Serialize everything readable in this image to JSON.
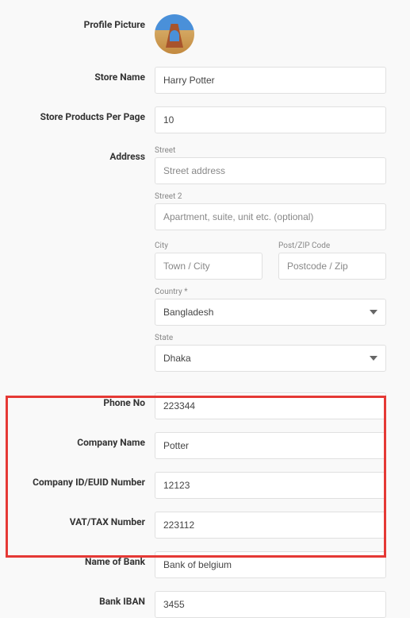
{
  "labels": {
    "profile_picture": "Profile Picture",
    "store_name": "Store Name",
    "products_per_page": "Store Products Per Page",
    "address": "Address",
    "street": "Street",
    "street2": "Street 2",
    "city": "City",
    "postzip": "Post/ZIP Code",
    "country": "Country *",
    "state": "State",
    "phone": "Phone No",
    "company_name": "Company Name",
    "company_id": "Company ID/EUID Number",
    "vat": "VAT/TAX Number",
    "bank_name": "Name of Bank",
    "bank_iban": "Bank IBAN"
  },
  "values": {
    "store_name": "Harry Potter",
    "products_per_page": "10",
    "street": "",
    "street2": "",
    "city": "",
    "postzip": "",
    "country": "Bangladesh",
    "state": "Dhaka",
    "phone": "223344",
    "company_name": "Potter",
    "company_id": "12123",
    "vat": "223112",
    "bank_name": "Bank of belgium",
    "bank_iban": "3455"
  },
  "placeholders": {
    "street": "Street address",
    "street2": "Apartment, suite, unit etc. (optional)",
    "city": "Town / City",
    "postzip": "Postcode / Zip"
  }
}
